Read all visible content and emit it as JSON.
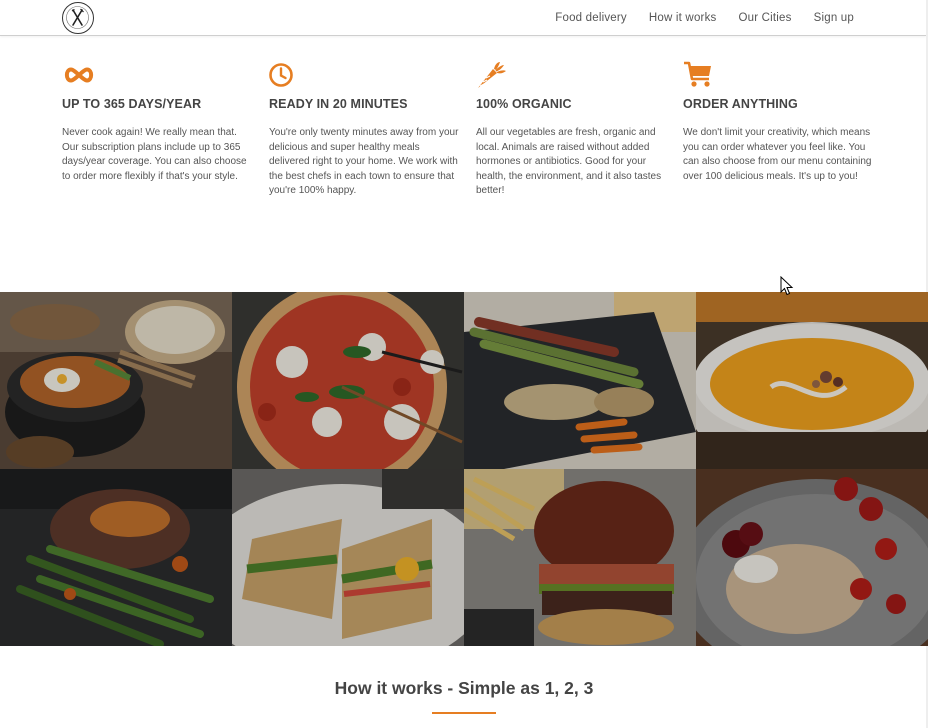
{
  "nav": {
    "logo_icon": "fork-knife-logo-icon",
    "links": [
      "Food delivery",
      "How it works",
      "Our Cities",
      "Sign up"
    ]
  },
  "accent_color": "#e67e22",
  "features": [
    {
      "icon": "infinity-icon",
      "title": "UP TO 365 DAYS/YEAR",
      "text": "Never cook again! We really mean that. Our subscription plans include up to 365 days/year coverage. You can also choose to order more flexibly if that's your style."
    },
    {
      "icon": "clock-icon",
      "title": "READY IN 20 MINUTES",
      "text": "You're only twenty minutes away from your delicious and super healthy meals delivered right to your home. We work with the best chefs in each town to ensure that you're 100% happy."
    },
    {
      "icon": "carrot-icon",
      "title": "100% ORGANIC",
      "text": "All our vegetables are fresh, organic and local. Animals are raised without added hormones or antibiotics. Good for your health, the environment, and it also tastes better!"
    },
    {
      "icon": "cart-icon",
      "title": "ORDER ANYTHING",
      "text": "We don't limit your creativity, which means you can order whatever you feel like. You can also choose from our menu containing over 100 delicious meals. It's up to you!"
    }
  ],
  "gallery": [
    "bibimbap-photo",
    "pizza-photo",
    "asparagus-chicken-photo",
    "pumpkin-soup-photo",
    "steak-green-beans-photo",
    "sandwich-photo",
    "burger-fries-photo",
    "granola-berries-photo"
  ],
  "how_it_works": {
    "title": "How it works - Simple as 1, 2, 3"
  }
}
